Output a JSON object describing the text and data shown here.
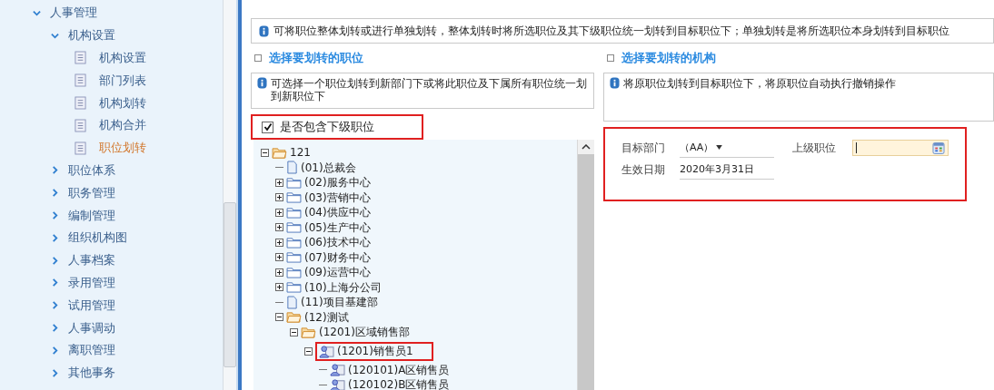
{
  "sidebar": {
    "items": [
      {
        "label": "人事管理",
        "kind": "group",
        "expanded": true,
        "children": [
          {
            "label": "机构设置",
            "kind": "group",
            "expanded": true,
            "children": [
              {
                "label": "机构设置",
                "kind": "page",
                "selected": false
              },
              {
                "label": "部门列表",
                "kind": "page",
                "selected": false
              },
              {
                "label": "机构划转",
                "kind": "page",
                "selected": false
              },
              {
                "label": "机构合并",
                "kind": "page",
                "selected": false
              },
              {
                "label": "职位划转",
                "kind": "page",
                "selected": true
              }
            ]
          },
          {
            "label": "职位体系",
            "kind": "group",
            "expanded": false
          },
          {
            "label": "职务管理",
            "kind": "group",
            "expanded": false
          },
          {
            "label": "编制管理",
            "kind": "group",
            "expanded": false
          },
          {
            "label": "组织机构图",
            "kind": "group",
            "expanded": false
          },
          {
            "label": "人事档案",
            "kind": "group",
            "expanded": false
          },
          {
            "label": "录用管理",
            "kind": "group",
            "expanded": false
          },
          {
            "label": "试用管理",
            "kind": "group",
            "expanded": false
          },
          {
            "label": "人事调动",
            "kind": "group",
            "expanded": false
          },
          {
            "label": "离职管理",
            "kind": "group",
            "expanded": false
          },
          {
            "label": "其他事务",
            "kind": "group",
            "expanded": false
          }
        ]
      }
    ]
  },
  "banner": {
    "text": "可将职位整体划转或进行单独划转，整体划转时将所选职位及其下级职位统一划转到目标职位下；单独划转是将所选职位本身划转到目标职位"
  },
  "left_panel": {
    "title": "选择要划转的职位",
    "info": "可选择一个职位划转到新部门下或将此职位及下属所有职位统一划到新职位下",
    "include_sub": {
      "label": "是否包含下级职位",
      "checked": true,
      "highlighted": true
    },
    "tree": [
      {
        "label": "121",
        "kind": "folder",
        "expanded": true,
        "highlighted": false,
        "children": [
          {
            "label": "(01)总裁会",
            "kind": "doc",
            "highlighted": false
          },
          {
            "label": "(02)服务中心",
            "kind": "folder",
            "expanded": false,
            "highlighted": false
          },
          {
            "label": "(03)营销中心",
            "kind": "folder",
            "expanded": false,
            "highlighted": false
          },
          {
            "label": "(04)供应中心",
            "kind": "folder",
            "expanded": false,
            "highlighted": false
          },
          {
            "label": "(05)生产中心",
            "kind": "folder",
            "expanded": false,
            "highlighted": false
          },
          {
            "label": "(06)技术中心",
            "kind": "folder",
            "expanded": false,
            "highlighted": false
          },
          {
            "label": "(07)财务中心",
            "kind": "folder",
            "expanded": false,
            "highlighted": false
          },
          {
            "label": "(09)运营中心",
            "kind": "folder",
            "expanded": false,
            "highlighted": false
          },
          {
            "label": "(10)上海分公司",
            "kind": "folder",
            "expanded": false,
            "highlighted": false
          },
          {
            "label": "(11)项目基建部",
            "kind": "doc",
            "highlighted": false
          },
          {
            "label": "(12)测试",
            "kind": "folder",
            "expanded": true,
            "highlighted": false,
            "children": [
              {
                "label": "(1201)区域销售部",
                "kind": "folder",
                "expanded": true,
                "highlighted": false,
                "children": [
                  {
                    "label": "(1201)销售员1",
                    "kind": "position",
                    "expanded": true,
                    "highlighted": true,
                    "children": [
                      {
                        "label": "(120101)A区销售员",
                        "kind": "position",
                        "highlighted": false
                      },
                      {
                        "label": "(120102)B区销售员",
                        "kind": "position",
                        "highlighted": false
                      }
                    ]
                  }
                ]
              }
            ]
          }
        ]
      }
    ]
  },
  "right_panel": {
    "title": "选择要划转的机构",
    "info": "将原职位划转到目标职位下，将原职位自动执行撤销操作",
    "form": {
      "highlighted": true,
      "target_department": {
        "label": "目标部门",
        "value": "（AA）"
      },
      "parent_position": {
        "label": "上级职位"
      },
      "effective_date": {
        "label": "生效日期",
        "value": "2020年3月31日"
      }
    }
  }
}
